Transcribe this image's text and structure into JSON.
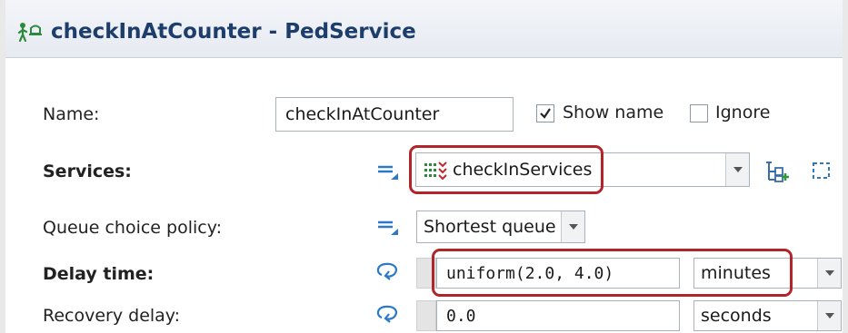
{
  "window": {
    "title": "checkInAtCounter - PedService"
  },
  "form": {
    "name": {
      "label": "Name:",
      "value": "checkInAtCounter"
    },
    "show_name": {
      "label": "Show name",
      "checked": true
    },
    "ignore": {
      "label": "Ignore",
      "checked": false
    },
    "services": {
      "label": "Services:",
      "value": "checkInServices"
    },
    "queue_policy": {
      "label": "Queue choice policy:",
      "value": "Shortest queue"
    },
    "delay_time": {
      "label": "Delay time:",
      "value": "uniform(2.0, 4.0)",
      "unit": "minutes"
    },
    "recovery_delay": {
      "label": "Recovery delay:",
      "value": "0.0",
      "unit": "seconds"
    }
  },
  "colors": {
    "title_text": "#1d3d6b",
    "highlight": "#b0242a",
    "field_border": "#a9b1bc",
    "icon_blue": "#2e79c7"
  },
  "icons": [
    "ped-service-icon",
    "static-value-icon",
    "services-collection-icon",
    "create-element-icon",
    "select-element-icon",
    "dynamic-value-icon"
  ]
}
